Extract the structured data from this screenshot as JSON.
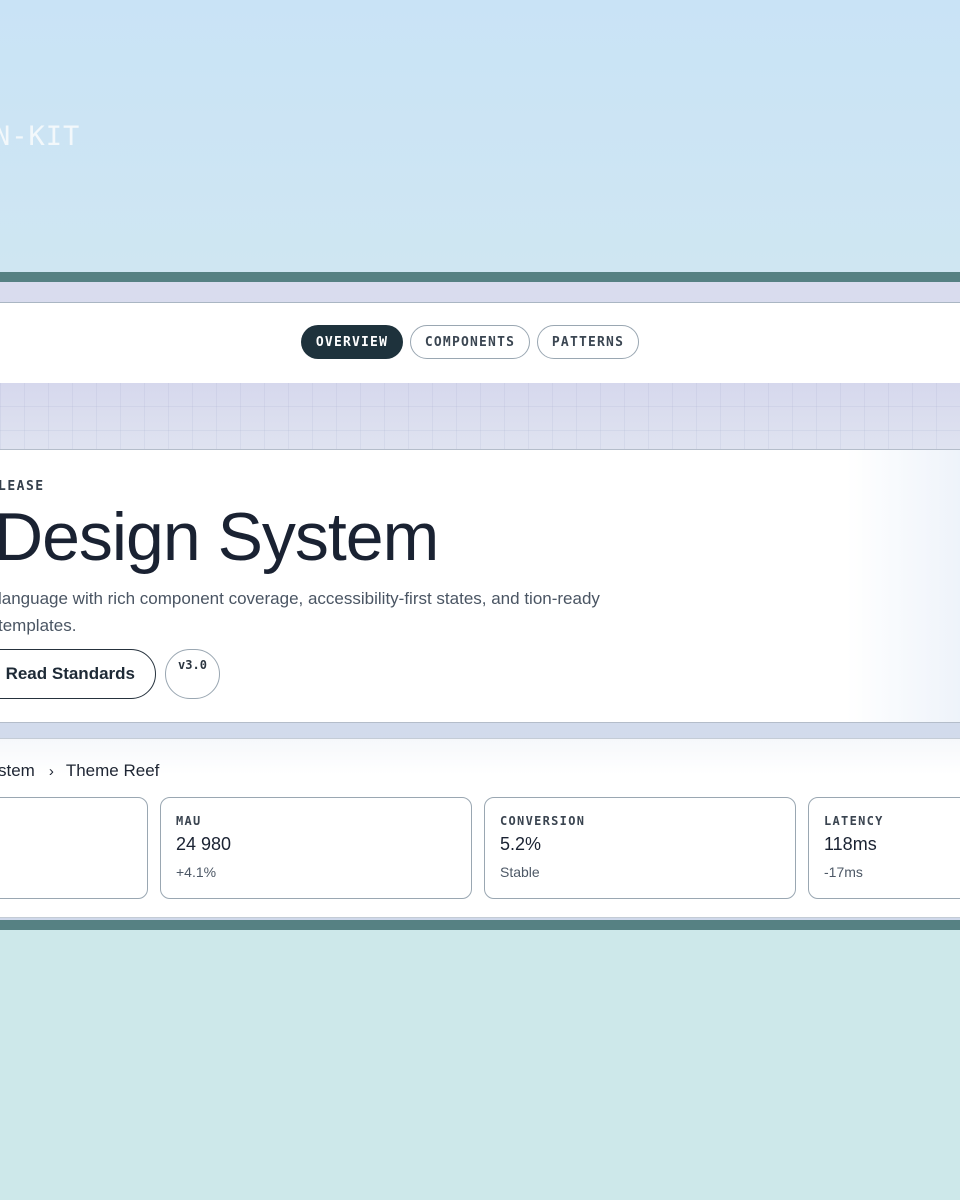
{
  "brand": {
    "text": "N-KIT"
  },
  "nav": {
    "tabs": [
      {
        "label": "OVERVIEW",
        "active": true
      },
      {
        "label": "COMPONENTS",
        "active": false
      },
      {
        "label": "PATTERNS",
        "active": false
      }
    ]
  },
  "hero": {
    "eyebrow": "LEASE",
    "title": "Design System",
    "description": "language with rich component coverage, accessibility-first states, and tion-ready templates.",
    "primary_button": "Read Standards",
    "version_badge": "v3.0"
  },
  "breadcrumb": {
    "parent": "stem",
    "separator": "›",
    "current": "Theme Reef"
  },
  "stats": [
    {
      "label": "",
      "value": "",
      "delta": ""
    },
    {
      "label": "MAU",
      "value": "24 980",
      "delta": "+4.1%"
    },
    {
      "label": "CONVERSION",
      "value": "5.2%",
      "delta": "Stable"
    },
    {
      "label": "LATENCY",
      "value": "118ms",
      "delta": "-17ms"
    }
  ],
  "colors": {
    "accent_dark": "#1e323c",
    "rule": "#568183",
    "background_top": "#c9e3f6",
    "background_bottom": "#cde8ea"
  }
}
